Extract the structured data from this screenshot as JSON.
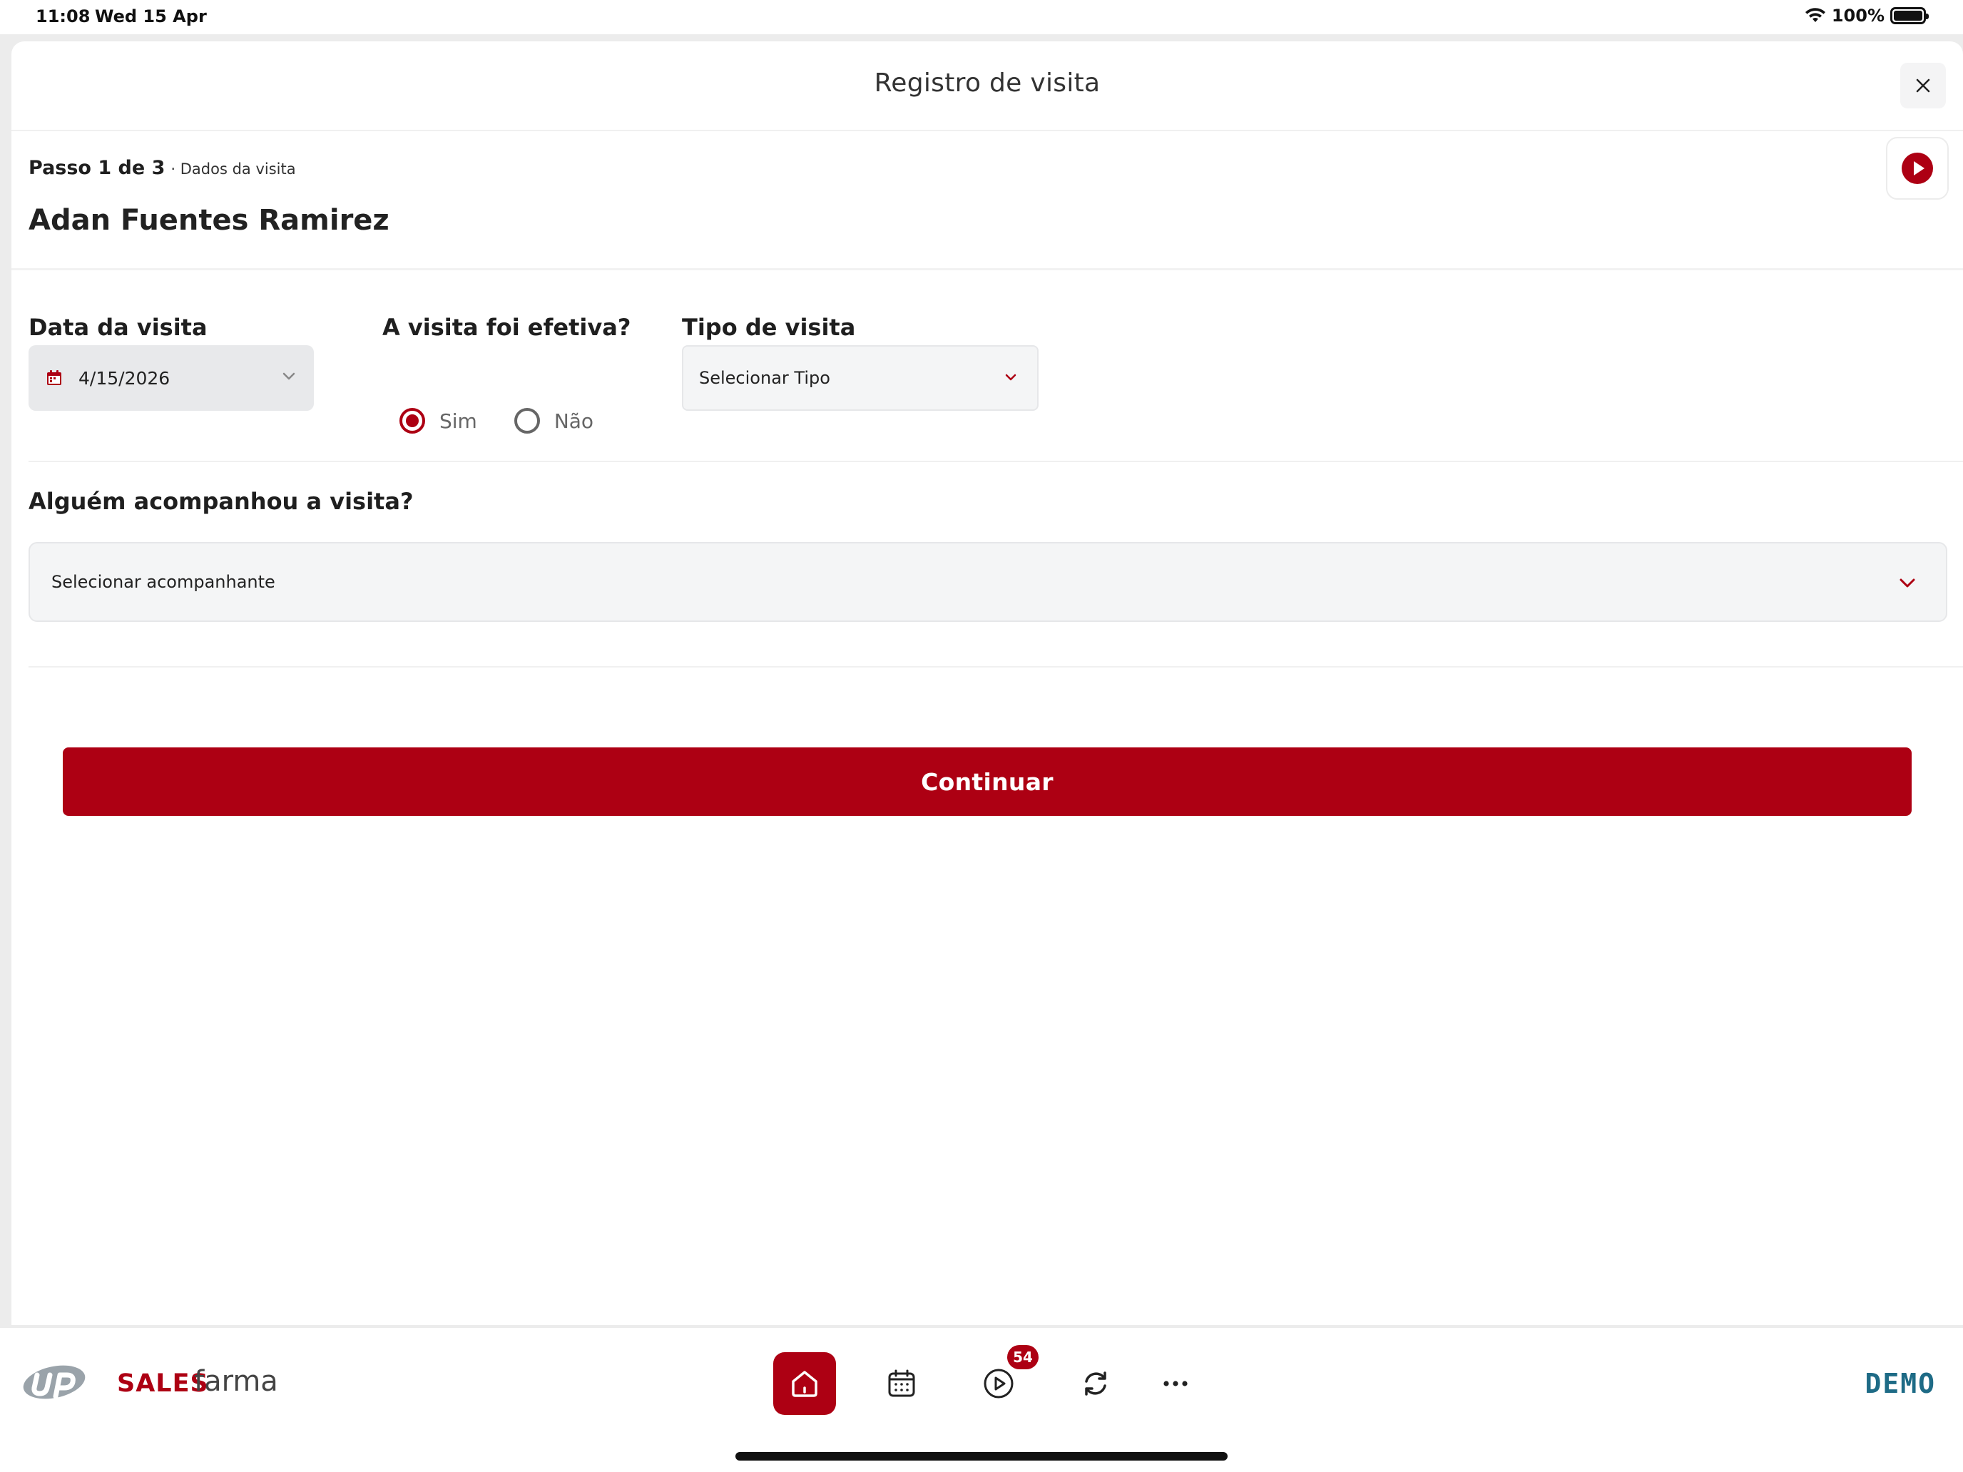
{
  "status_bar": {
    "time": "11:08",
    "date": "Wed 15 Apr",
    "battery": "100%",
    "icons": [
      "wifi-icon",
      "battery-icon"
    ]
  },
  "header": {
    "title": "Registro de visita",
    "close_icon": "close-icon"
  },
  "step": {
    "label": "Passo 1 de 3",
    "subtitle": "· Dados da visita"
  },
  "patient": {
    "name": "Adan Fuentes Ramirez"
  },
  "form": {
    "visit_date": {
      "label": "Data da visita",
      "value": "4/15/2026",
      "icon": "calendar-icon"
    },
    "effective": {
      "label": "A visita foi efetiva?",
      "options": [
        {
          "label": "Sim",
          "checked": true
        },
        {
          "label": "Não",
          "checked": false
        }
      ]
    },
    "visit_type": {
      "label": "Tipo de visita",
      "placeholder": "Selecionar Tipo"
    },
    "companion": {
      "label": "Alguém acompanhou a visita?",
      "placeholder": "Selecionar acompanhante"
    }
  },
  "actions": {
    "continue_label": "Continuar"
  },
  "tabbar": {
    "brand_sales": "SALES",
    "brand_farma": "farma",
    "tabs": [
      {
        "name": "home",
        "icon": "home-icon",
        "active": true
      },
      {
        "name": "calendar",
        "icon": "calendar-icon",
        "active": false
      },
      {
        "name": "play",
        "icon": "play-circle-icon",
        "active": false,
        "badge": "54"
      },
      {
        "name": "sync",
        "icon": "sync-icon",
        "active": false
      },
      {
        "name": "more",
        "icon": "more-icon",
        "active": false
      }
    ],
    "demo_label": "DEMO"
  },
  "colors": {
    "accent": "#ad0013",
    "demo": "#1e6b86"
  }
}
